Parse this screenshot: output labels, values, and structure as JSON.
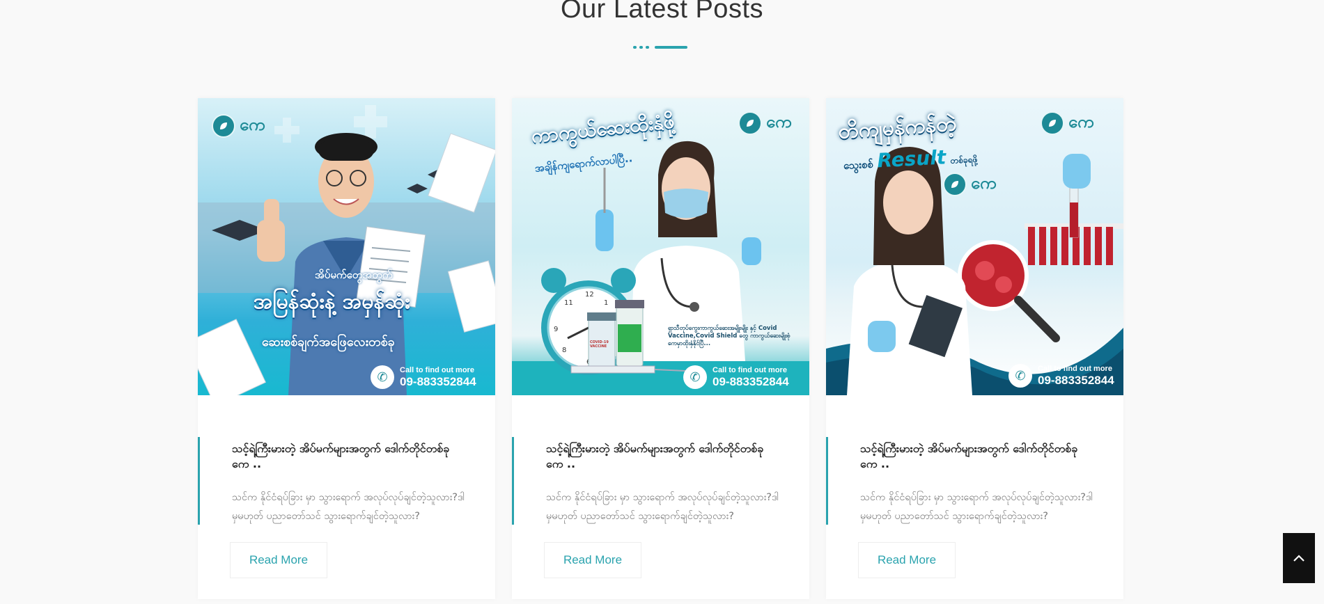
{
  "section": {
    "title": "Our Latest Posts"
  },
  "colors": {
    "accent": "#2aa3ae",
    "brand": "#1d8a96"
  },
  "posts": [
    {
      "title": "သင့်ရဲ့ကြီးမားတဲ့ အိပ်မက်များအတွက် ဒေါက်တိုင်တစ်ခု ကေ ..",
      "excerpt": "သင်က နိုင်ငံရပ်ခြား မှာ သွားရောက် အလုပ်လုပ်ချင်တဲ့သူလား?ဒါမှမဟုတ် ပညာတော်သင် သွားရောက်ချင်တဲ့သူလား?",
      "button": "Read More",
      "image": {
        "logo": "ကေ",
        "headline_1": "အိပ်မက်တွေအတွက်",
        "headline_2": "အမြန်ဆုံးနဲ့ အမှန်ဆုံး",
        "headline_3": "ဆေးစစ်ချက်အဖြေလေးတစ်ခု",
        "phone_caption": "Call to find out more",
        "phone_number": "09-883352844"
      }
    },
    {
      "title": "သင့်ရဲ့ကြီးမားတဲ့ အိပ်မက်များအတွက် ဒေါက်တိုင်တစ်ခု ကေ ..",
      "excerpt": "သင်က နိုင်ငံရပ်ခြား မှာ သွားရောက် အလုပ်လုပ်ချင်တဲ့သူလား?ဒါမှမဟုတ် ပညာတော်သင် သွားရောက်ချင်တဲ့သူလား?",
      "button": "Read More",
      "image": {
        "logo": "ကေ",
        "headline_1": "ကာကွယ်ဆေးထိုးနှံဖို့",
        "headline_2": "အချိန်ကျရောက်လာပါပြီ..",
        "note": "ရှာသီတုပ်ကွေးကာကွယ်ဆေးအမျိုးမျိုး နှင့် Covid Vaccine,Covid Shield တွေ ကာကွယ်ဆေးမျိုးစုံ ကေမှာထိုးနှံနိုင်ပြီ...",
        "vial_label": "COVID-19 VACCINE",
        "phone_caption": "Call to find out more",
        "phone_number": "09-883352844"
      }
    },
    {
      "title": "သင့်ရဲ့ကြီးမားတဲ့ အိပ်မက်များအတွက် ဒေါက်တိုင်တစ်ခု ကေ ..",
      "excerpt": "သင်က နိုင်ငံရပ်ခြား မှာ သွားရောက် အလုပ်လုပ်ချင်တဲ့သူလား?ဒါမှမဟုတ် ပညာတော်သင် သွားရောက်ချင်တဲ့သူလား?",
      "button": "Read More",
      "image": {
        "logo": "ကေ",
        "headline_1": "တိကျမှန်ကန်တဲ့",
        "headline_2a": "သွေးစစ်",
        "headline_2b": "Result",
        "headline_2c": "တစ်ခုရဖို့",
        "phone_caption": "Call to find out more",
        "phone_number": "09-883352844"
      }
    }
  ],
  "scroll_top": {
    "icon": "chevron-up-icon"
  }
}
